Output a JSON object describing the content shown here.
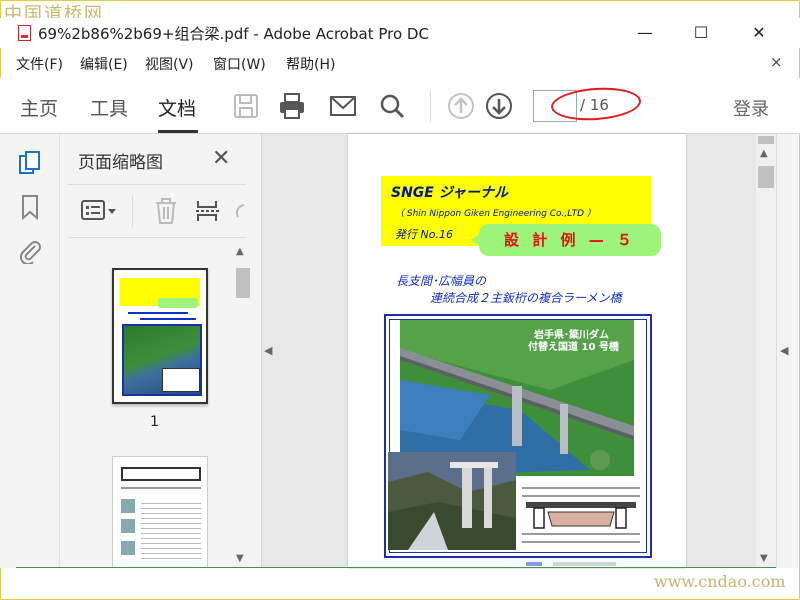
{
  "watermark": {
    "top": "中国道桥网",
    "bottom": "www.cndao.com"
  },
  "window": {
    "title": "69%2b86%2b69+组合梁.pdf - Adobe Acrobat Pro DC",
    "minimize": "—",
    "maximize": "☐",
    "close": "✕"
  },
  "menu": {
    "items": [
      "文件(F)",
      "编辑(E)",
      "视图(V)",
      "窗口(W)",
      "帮助(H)"
    ],
    "close": "×"
  },
  "toolbar": {
    "tabs": [
      "主页",
      "工具",
      "文档"
    ],
    "active_tab": "文档",
    "page_current": "",
    "page_total": "/ 16",
    "login": "登录"
  },
  "thumbnails": {
    "title": "页面缩略图",
    "close": "✕",
    "page_label": "1"
  },
  "document": {
    "journal": "SNGE ジャーナル",
    "company": "（ Shin Nippon Giken Engineering Co.,LTD ）",
    "issue": "発行  No.16",
    "design_example": "設 計 例 — ５",
    "subtitle1": "長支間･広幅員の",
    "subtitle2": "連続合成２主鈑桁の複合ラーメン橋",
    "caption1": "岩手県･簗川ダム",
    "caption2": "付替え国道 10 号橋"
  },
  "colors": {
    "highlight_yellow": "#ffff00",
    "badge_green": "#9df57a",
    "badge_red_text": "#e61010",
    "doc_blue": "#1030c8",
    "annotation_red": "#e21b1b",
    "acrobat_blue": "#1a73c8"
  },
  "icons": {
    "pages_panel": "pages-icon",
    "bookmarks_panel": "bookmark-icon",
    "attachments_panel": "paperclip-icon",
    "save": "save-icon",
    "print": "print-icon",
    "email": "email-icon",
    "search": "search-icon",
    "prev_page": "arrow-up-icon",
    "next_page": "arrow-down-icon"
  }
}
